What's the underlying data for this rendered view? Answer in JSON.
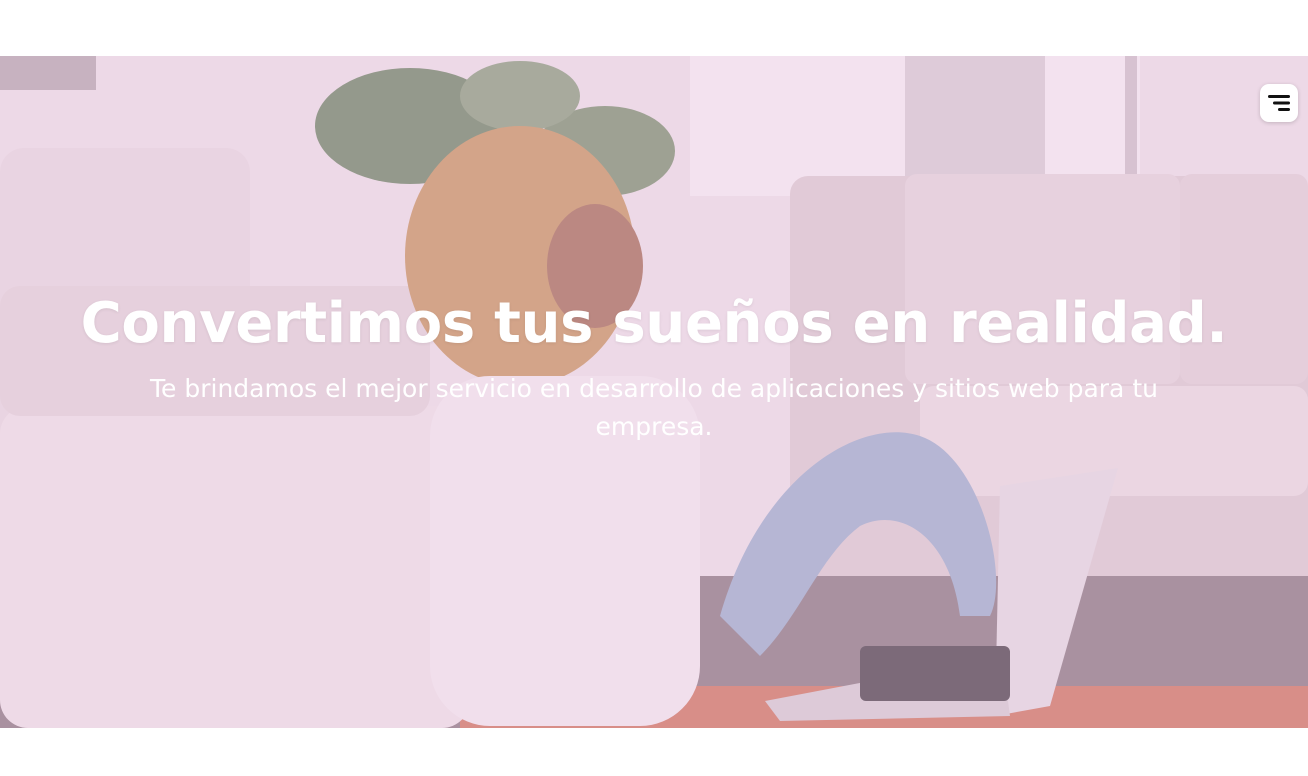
{
  "header": {
    "menu_icon": "hamburger-menu-icon"
  },
  "hero": {
    "title": "Convertimos tus sueños en realidad.",
    "subtitle": "Te brindamos el mejor servicio en desarrollo de aplicaciones y sitios web para tu empresa.",
    "background_image": "woman-with-laptop-on-floor-photo",
    "overlay_color": "#ecbee2",
    "text_color": "#ffffff"
  }
}
